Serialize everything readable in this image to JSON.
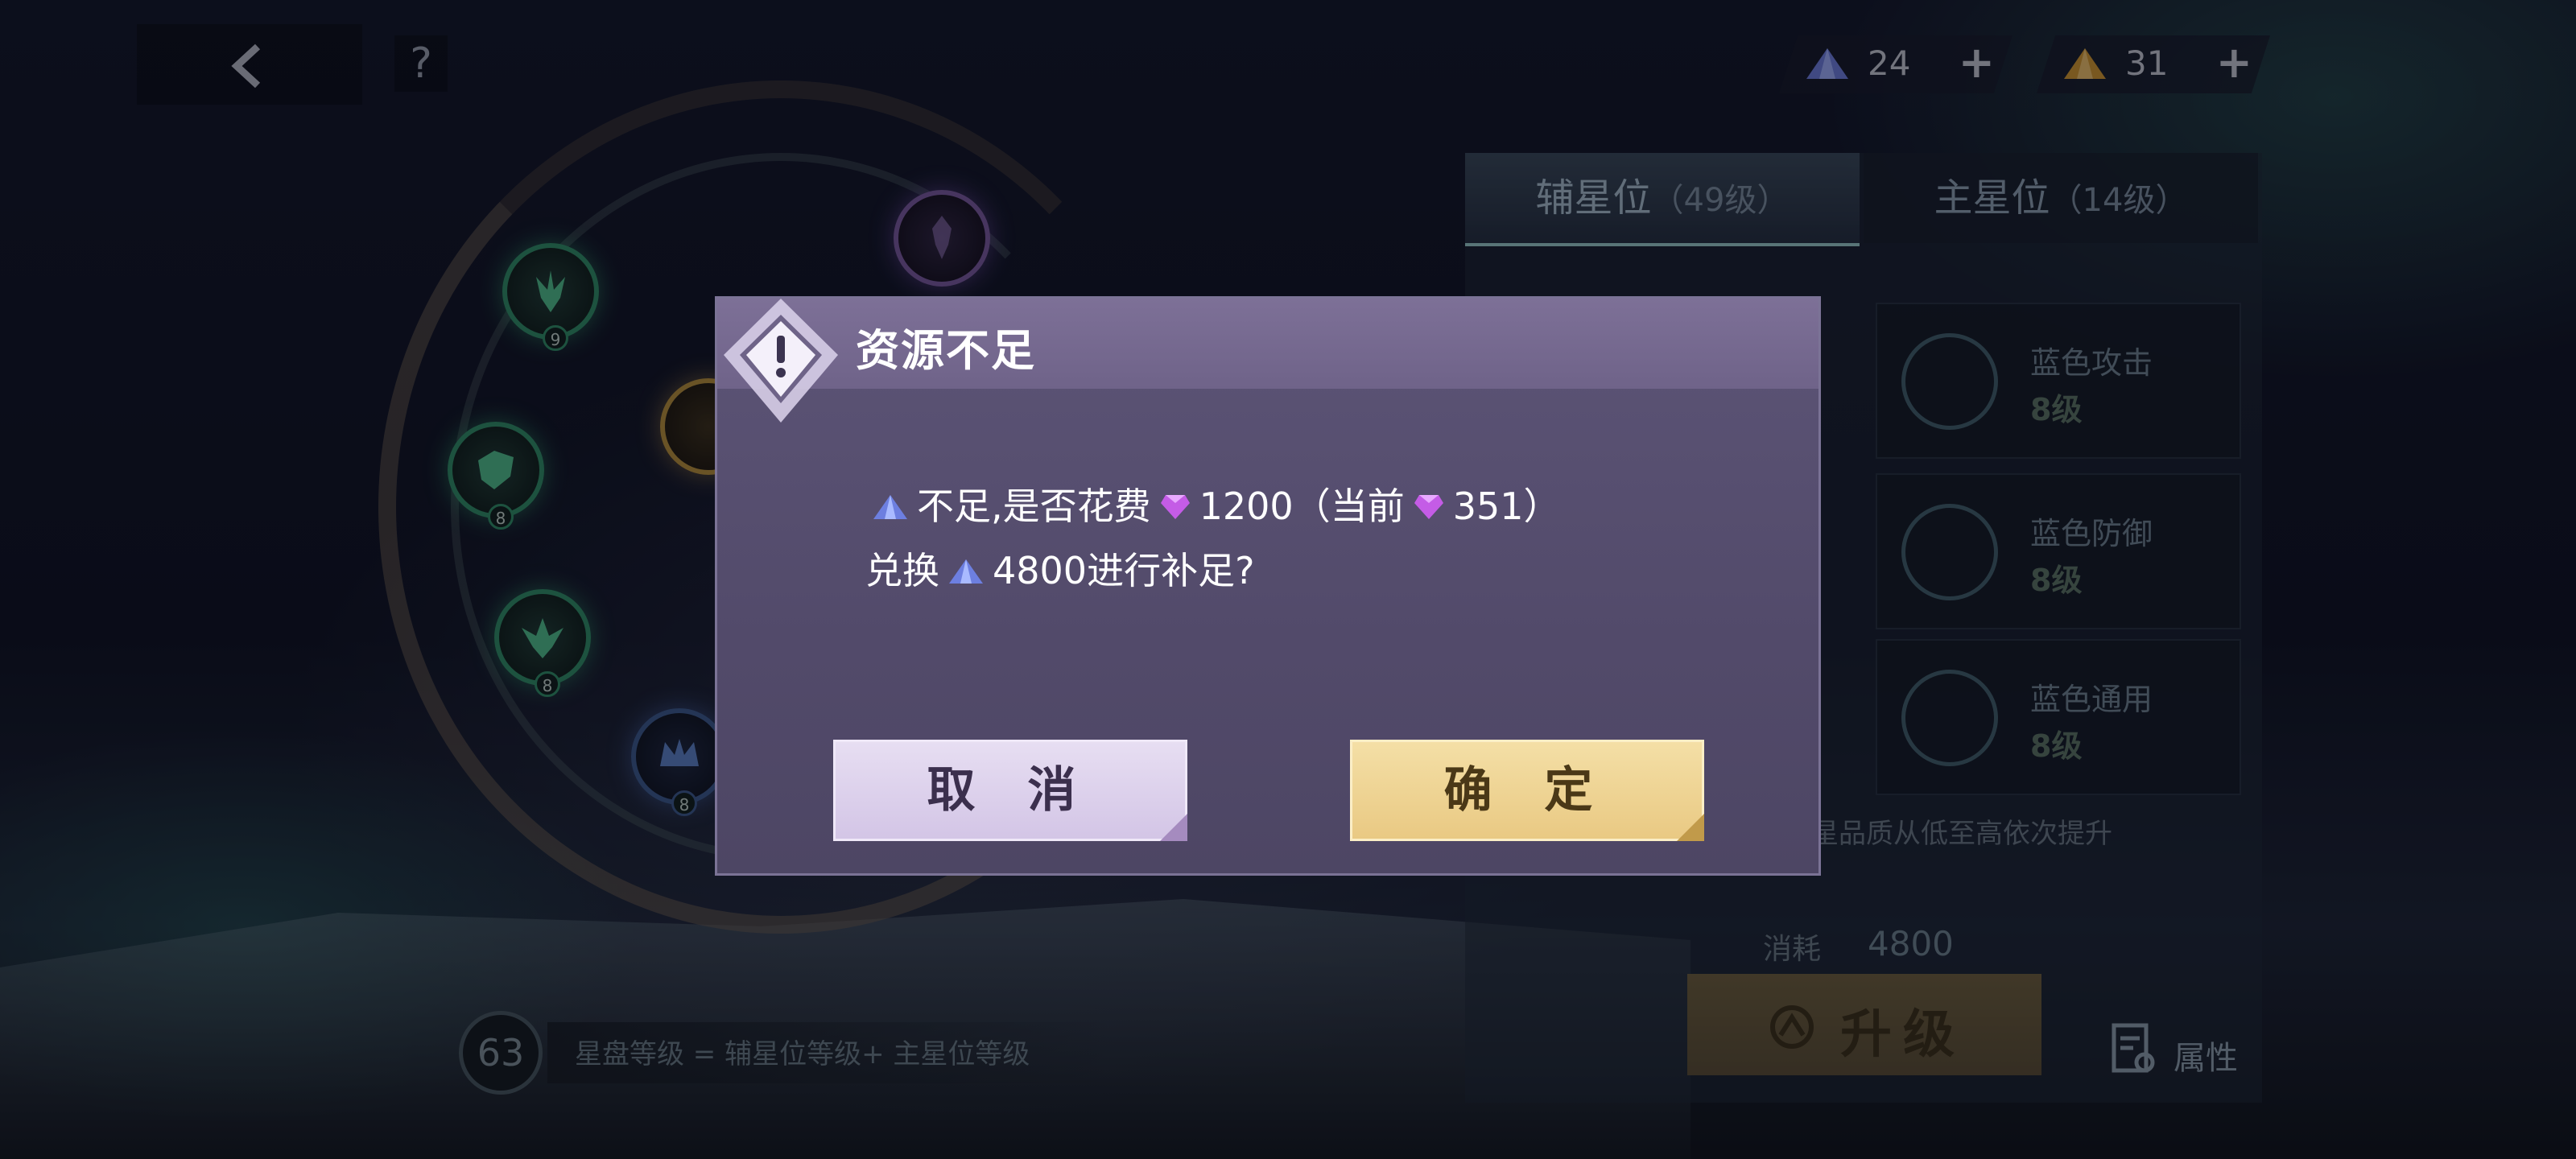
{
  "top": {
    "back_icon": "chevron-left-icon",
    "help_label": "?",
    "currencies": [
      {
        "icon": "blue-crystal-icon",
        "value": "24",
        "plus": "+"
      },
      {
        "icon": "gold-crystal-icon",
        "value": "31",
        "plus": "+"
      }
    ]
  },
  "ring": {
    "nodes": [
      {
        "level": "9"
      },
      {
        "level": "8"
      },
      {
        "level": "8"
      },
      {
        "level": "8"
      }
    ]
  },
  "panel": {
    "tabs": [
      {
        "label": "辅星位",
        "sub": "（49级）"
      },
      {
        "label": "主星位",
        "sub": "（14级）"
      }
    ],
    "attributes": [
      {
        "name": "蓝色攻击",
        "level": "8级"
      },
      {
        "name": "蓝色防御",
        "level": "8级"
      },
      {
        "name": "蓝色通用",
        "level": "8级"
      }
    ],
    "tip": "星品质从低至高依次提升",
    "cost_label": "消耗",
    "cost_value": "4800",
    "upgrade_label": "升级",
    "attr_label": "属性"
  },
  "bottom": {
    "level": "63",
    "formula": "星盘等级 = 辅星位等级+ 主星位等级"
  },
  "dialog": {
    "title": "资源不足",
    "line1_a": "不足,是否花费",
    "line1_b": "1200（当前",
    "line1_c": "351）",
    "line2_a": "兑换",
    "line2_b": "4800进行补足?",
    "cancel_label": "取 消",
    "confirm_label": "确 定"
  },
  "colors": {
    "dialog_bg": "#5c5476",
    "dialog_header": "#7d7097",
    "cancel_btn": "#e7def2",
    "confirm_btn": "#f4dfa6"
  }
}
